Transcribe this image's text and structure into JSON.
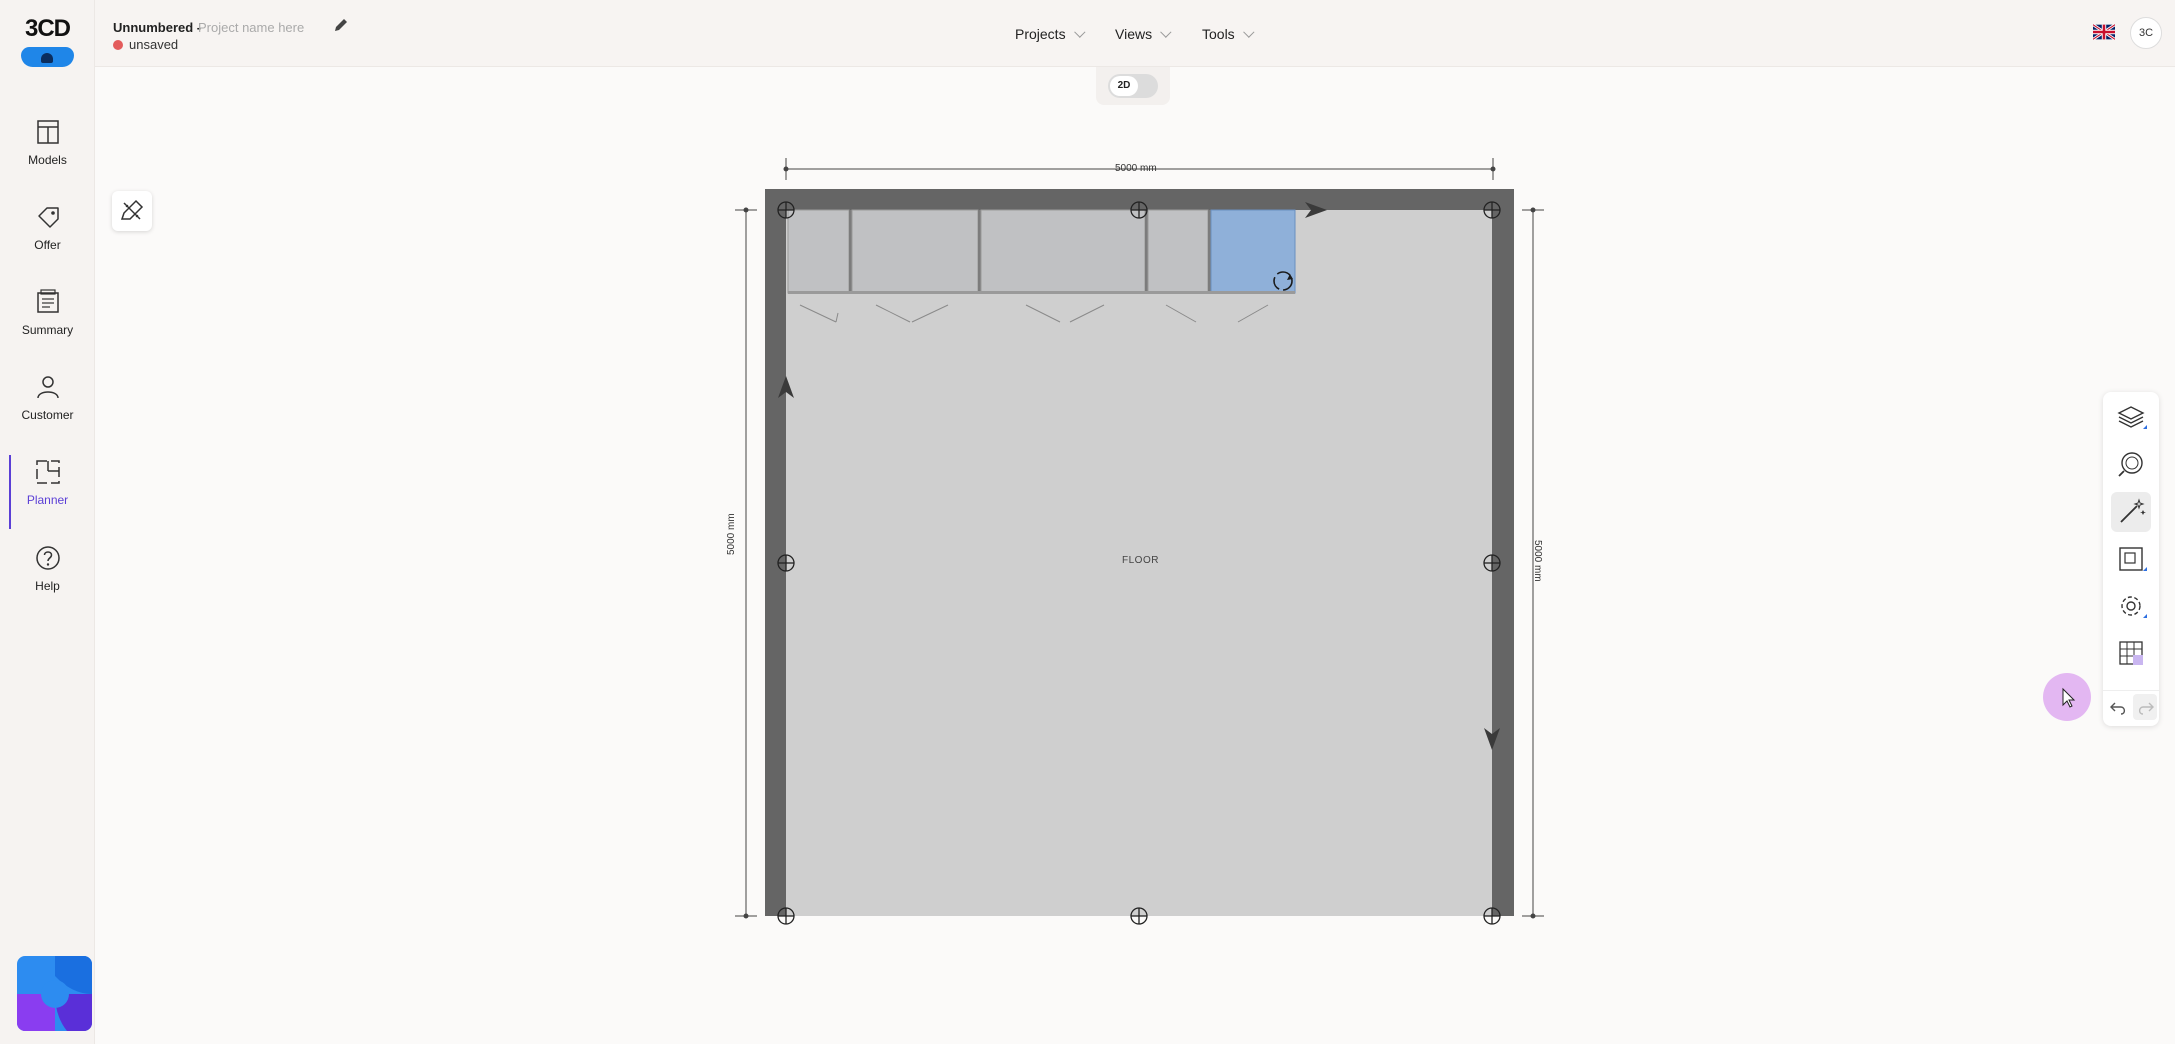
{
  "app": {
    "logo_text": "3CD"
  },
  "sidebar": {
    "items": [
      {
        "label": "Models",
        "icon": "models-icon"
      },
      {
        "label": "Offer",
        "icon": "tag-icon"
      },
      {
        "label": "Summary",
        "icon": "summary-icon"
      },
      {
        "label": "Customer",
        "icon": "customer-icon"
      },
      {
        "label": "Planner",
        "icon": "planner-icon",
        "active": true
      },
      {
        "label": "Help",
        "icon": "help-icon"
      }
    ],
    "active_color": "#5b3fd6"
  },
  "header": {
    "project_number": "Unnumbered -",
    "project_name_placeholder": "Project name here",
    "status": "unsaved",
    "status_color": "#e35b5b",
    "menus": [
      {
        "label": "Projects"
      },
      {
        "label": "Views"
      },
      {
        "label": "Tools"
      }
    ],
    "language_flag": "uk-flag-icon",
    "user_initials": "3C"
  },
  "view_toggle": {
    "label": "2D"
  },
  "planner": {
    "floor_label": "FLOOR",
    "dimension_top": "5000 mm",
    "dimension_left": "5000 mm",
    "dimension_right": "5000 mm",
    "selected_cabinet_color": "#8fb0d9",
    "wall_color": "#666666",
    "floor_color": "#cfcfcf"
  },
  "right_toolbar": {
    "tools": [
      "layers-icon",
      "zoom-icon",
      "magic-wand-icon",
      "select-area-icon",
      "settings-icon",
      "grid-icon"
    ],
    "undo": "undo-icon",
    "redo": "redo-icon"
  }
}
